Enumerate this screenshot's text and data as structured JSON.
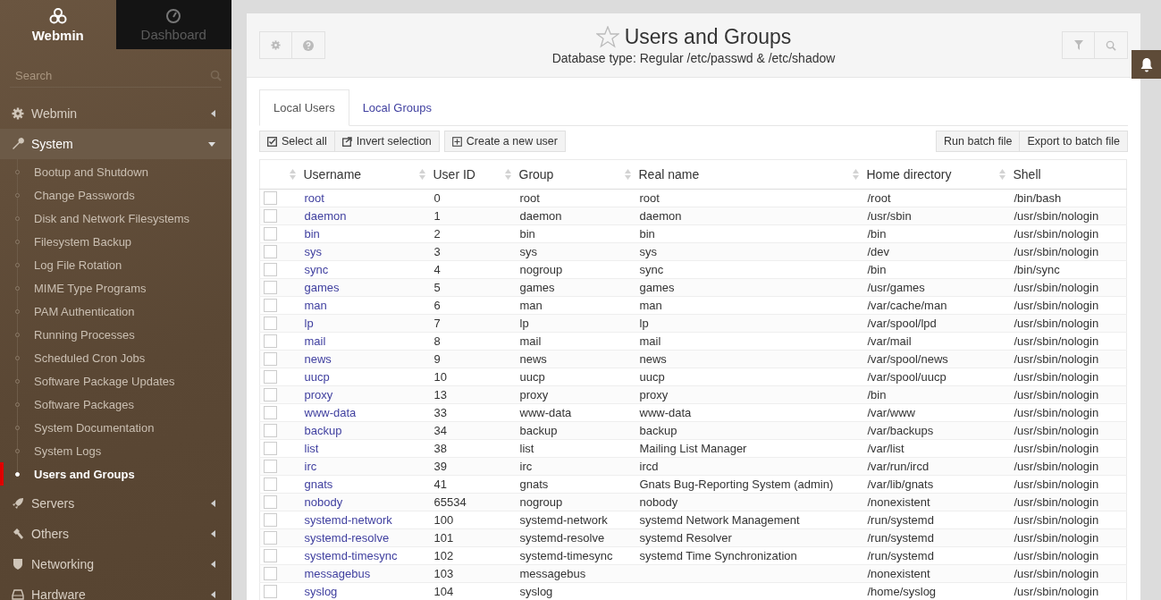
{
  "sidebar": {
    "tabs": [
      {
        "label": "Webmin",
        "selected": true
      },
      {
        "label": "Dashboard",
        "selected": false
      }
    ],
    "search": {
      "placeholder": "Search"
    },
    "menu": [
      {
        "label": "Webmin",
        "expanded": false
      },
      {
        "label": "System",
        "expanded": true,
        "children": [
          {
            "label": "Bootup and Shutdown",
            "selected": false
          },
          {
            "label": "Change Passwords",
            "selected": false
          },
          {
            "label": "Disk and Network Filesystems",
            "selected": false
          },
          {
            "label": "Filesystem Backup",
            "selected": false
          },
          {
            "label": "Log File Rotation",
            "selected": false
          },
          {
            "label": "MIME Type Programs",
            "selected": false
          },
          {
            "label": "PAM Authentication",
            "selected": false
          },
          {
            "label": "Running Processes",
            "selected": false
          },
          {
            "label": "Scheduled Cron Jobs",
            "selected": false
          },
          {
            "label": "Software Package Updates",
            "selected": false
          },
          {
            "label": "Software Packages",
            "selected": false
          },
          {
            "label": "System Documentation",
            "selected": false
          },
          {
            "label": "System Logs",
            "selected": false
          },
          {
            "label": "Users and Groups",
            "selected": true
          }
        ]
      },
      {
        "label": "Servers",
        "expanded": false
      },
      {
        "label": "Others",
        "expanded": false
      },
      {
        "label": "Networking",
        "expanded": false
      },
      {
        "label": "Hardware",
        "expanded": false
      }
    ]
  },
  "page": {
    "title": "Users and Groups",
    "subtitle": "Database type: Regular /etc/passwd & /etc/shadow"
  },
  "tabs": [
    {
      "label": "Local Users",
      "selected": true
    },
    {
      "label": "Local Groups",
      "selected": false
    }
  ],
  "toolbar": {
    "left": [
      "Select all",
      "Invert selection",
      "Create a new user"
    ],
    "right": [
      "Run batch file",
      "Export to batch file"
    ]
  },
  "table": {
    "columns": [
      "Username",
      "User ID",
      "Group",
      "Real name",
      "Home directory",
      "Shell"
    ],
    "rows": [
      {
        "checked": false,
        "cells": [
          "root",
          "0",
          "root",
          "root",
          "/root",
          "/bin/bash"
        ]
      },
      {
        "checked": false,
        "cells": [
          "daemon",
          "1",
          "daemon",
          "daemon",
          "/usr/sbin",
          "/usr/sbin/nologin"
        ]
      },
      {
        "checked": false,
        "cells": [
          "bin",
          "2",
          "bin",
          "bin",
          "/bin",
          "/usr/sbin/nologin"
        ]
      },
      {
        "checked": false,
        "cells": [
          "sys",
          "3",
          "sys",
          "sys",
          "/dev",
          "/usr/sbin/nologin"
        ]
      },
      {
        "checked": false,
        "cells": [
          "sync",
          "4",
          "nogroup",
          "sync",
          "/bin",
          "/bin/sync"
        ]
      },
      {
        "checked": false,
        "cells": [
          "games",
          "5",
          "games",
          "games",
          "/usr/games",
          "/usr/sbin/nologin"
        ]
      },
      {
        "checked": false,
        "cells": [
          "man",
          "6",
          "man",
          "man",
          "/var/cache/man",
          "/usr/sbin/nologin"
        ]
      },
      {
        "checked": false,
        "cells": [
          "lp",
          "7",
          "lp",
          "lp",
          "/var/spool/lpd",
          "/usr/sbin/nologin"
        ]
      },
      {
        "checked": false,
        "cells": [
          "mail",
          "8",
          "mail",
          "mail",
          "/var/mail",
          "/usr/sbin/nologin"
        ]
      },
      {
        "checked": false,
        "cells": [
          "news",
          "9",
          "news",
          "news",
          "/var/spool/news",
          "/usr/sbin/nologin"
        ]
      },
      {
        "checked": false,
        "cells": [
          "uucp",
          "10",
          "uucp",
          "uucp",
          "/var/spool/uucp",
          "/usr/sbin/nologin"
        ]
      },
      {
        "checked": false,
        "cells": [
          "proxy",
          "13",
          "proxy",
          "proxy",
          "/bin",
          "/usr/sbin/nologin"
        ]
      },
      {
        "checked": false,
        "cells": [
          "www-data",
          "33",
          "www-data",
          "www-data",
          "/var/www",
          "/usr/sbin/nologin"
        ]
      },
      {
        "checked": false,
        "cells": [
          "backup",
          "34",
          "backup",
          "backup",
          "/var/backups",
          "/usr/sbin/nologin"
        ]
      },
      {
        "checked": false,
        "cells": [
          "list",
          "38",
          "list",
          "Mailing List Manager",
          "/var/list",
          "/usr/sbin/nologin"
        ]
      },
      {
        "checked": false,
        "cells": [
          "irc",
          "39",
          "irc",
          "ircd",
          "/var/run/ircd",
          "/usr/sbin/nologin"
        ]
      },
      {
        "checked": false,
        "cells": [
          "gnats",
          "41",
          "gnats",
          "Gnats Bug-Reporting System (admin)",
          "/var/lib/gnats",
          "/usr/sbin/nologin"
        ]
      },
      {
        "checked": false,
        "cells": [
          "nobody",
          "65534",
          "nogroup",
          "nobody",
          "/nonexistent",
          "/usr/sbin/nologin"
        ]
      },
      {
        "checked": false,
        "cells": [
          "systemd-network",
          "100",
          "systemd-network",
          "systemd Network Management",
          "/run/systemd",
          "/usr/sbin/nologin"
        ]
      },
      {
        "checked": false,
        "cells": [
          "systemd-resolve",
          "101",
          "systemd-resolve",
          "systemd Resolver",
          "/run/systemd",
          "/usr/sbin/nologin"
        ]
      },
      {
        "checked": false,
        "cells": [
          "systemd-timesync",
          "102",
          "systemd-timesync",
          "systemd Time Synchronization",
          "/run/systemd",
          "/usr/sbin/nologin"
        ]
      },
      {
        "checked": false,
        "cells": [
          "messagebus",
          "103",
          "messagebus",
          "",
          "/nonexistent",
          "/usr/sbin/nologin"
        ]
      },
      {
        "checked": false,
        "cells": [
          "syslog",
          "104",
          "syslog",
          "",
          "/home/syslog",
          "/usr/sbin/nologin"
        ]
      }
    ]
  }
}
